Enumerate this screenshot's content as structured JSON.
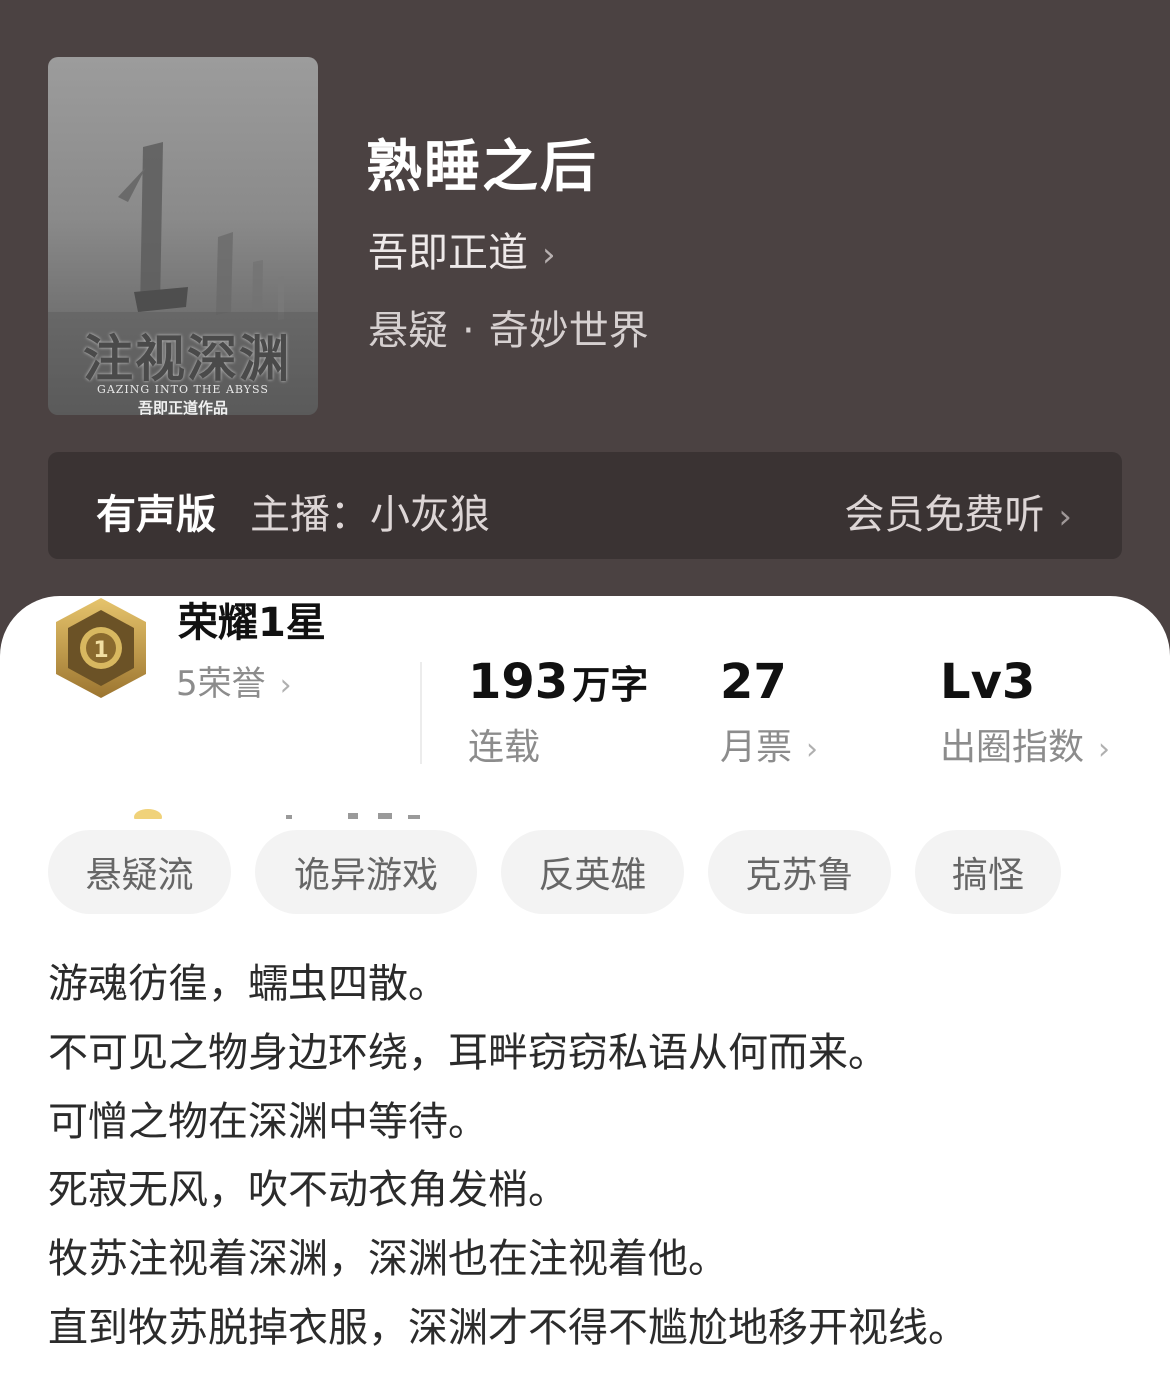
{
  "book": {
    "title": "熟睡之后",
    "author": "吾即正道",
    "genre": "悬疑",
    "subgenre": "奇妙世界",
    "cover": {
      "title_text": "注视深渊",
      "subtitle_text": "GAZING INTO THE ABYSS",
      "author_text": "吾即正道作品"
    }
  },
  "audio": {
    "label": "有声版",
    "host": "主播：小灰狼",
    "cta": "会员免费听"
  },
  "honor": {
    "title": "荣耀1星",
    "count": "5荣誉",
    "badge_number": "1"
  },
  "stats": {
    "words": {
      "value": "193",
      "unit": "万字",
      "label": "连载"
    },
    "monthly_votes": {
      "value": "27",
      "label": "月票"
    },
    "popularity": {
      "value": "Lv3",
      "label": "出圈指数"
    }
  },
  "tags": [
    "悬疑流",
    "诡异游戏",
    "反英雄",
    "克苏鲁",
    "搞怪"
  ],
  "synopsis": [
    "游魂彷徨，蠕虫四散。",
    "不可见之物身边环绕，耳畔窃窃私语从何而来。",
    "可憎之物在深渊中等待。",
    "死寂无风，吹不动衣角发梢。",
    "牧苏注视着深渊，深渊也在注视着他。",
    "直到牧苏脱掉衣服，深渊才不得不尴尬地移开视线。"
  ],
  "icons": {
    "chevron": "chevron-right-icon",
    "badge": "honor-badge-icon"
  },
  "colors": {
    "header_bg": "#4b4242",
    "audio_bar_bg": "#3a3333",
    "card_bg": "#ffffff",
    "tag_bg": "#f3f3f3",
    "badge_gold": "#c9a24a"
  }
}
